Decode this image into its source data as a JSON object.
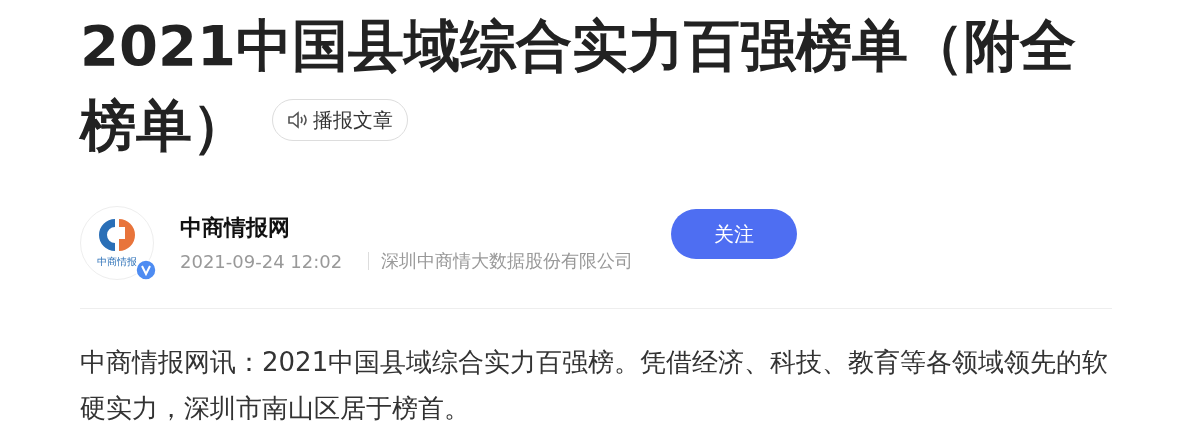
{
  "article": {
    "title": "2021中国县域综合实力百强榜单（附全榜单）",
    "listen_button": "播报文章"
  },
  "author": {
    "avatar_caption": "中商情报",
    "verified": true,
    "name": "中商情报网",
    "time": "2021-09-24 12:02",
    "organization": "深圳中商情大数据股份有限公司",
    "follow_button": "关注"
  },
  "body": {
    "paragraph": "中商情报网讯：2021中国县域综合实力百强榜。凭借经济、科技、教育等各领域领先的软硬实力，深圳市南山区居于榜首。"
  }
}
